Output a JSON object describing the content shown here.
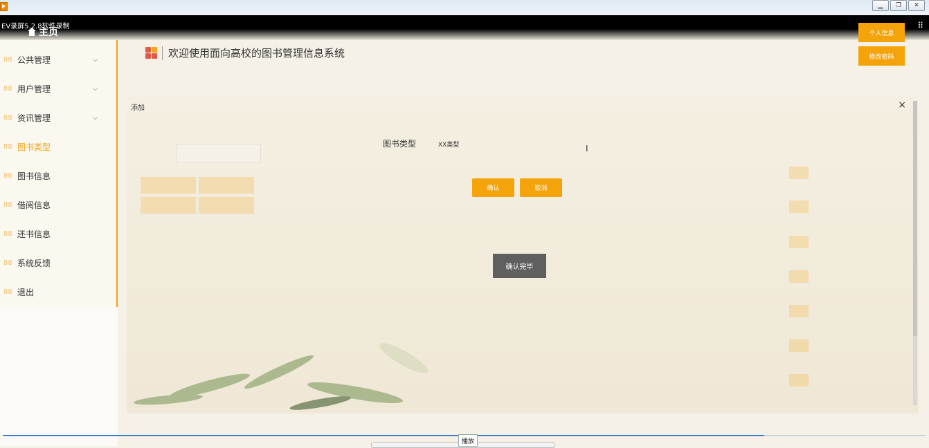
{
  "window": {
    "recorder_label": "EV录屏5.2.8软件录制",
    "minimize_glyph": "▁",
    "restore_glyph": "❐",
    "close_glyph": "✕"
  },
  "header": {
    "home_title": "主页",
    "welcome": "欢迎使用面向高校的图书管理信息系统",
    "user_buttons": [
      "个人信息",
      "修改密码"
    ]
  },
  "sidebar": {
    "items": [
      {
        "label": "公共管理",
        "chevron": "⌵"
      },
      {
        "label": "用户管理",
        "chevron": "⌵"
      },
      {
        "label": "资讯管理",
        "chevron": "⌵"
      },
      {
        "label": "图书类型"
      },
      {
        "label": "图书信息"
      },
      {
        "label": "借阅信息"
      },
      {
        "label": "还书信息"
      },
      {
        "label": "系统反馈"
      },
      {
        "label": "退出"
      }
    ],
    "icon_glyph": "88"
  },
  "dialog": {
    "title": "添加",
    "close": "×",
    "field_label": "图书类型",
    "field_value": "XX类型",
    "confirm_label": "确认",
    "cancel_label": "取消",
    "done_label": "确认完毕"
  },
  "player": {
    "play_label": "播放"
  },
  "colors": {
    "accent": "#f5a30a",
    "sidebar_active": "#f3a41a",
    "dark_button": "#5f5f5f"
  }
}
